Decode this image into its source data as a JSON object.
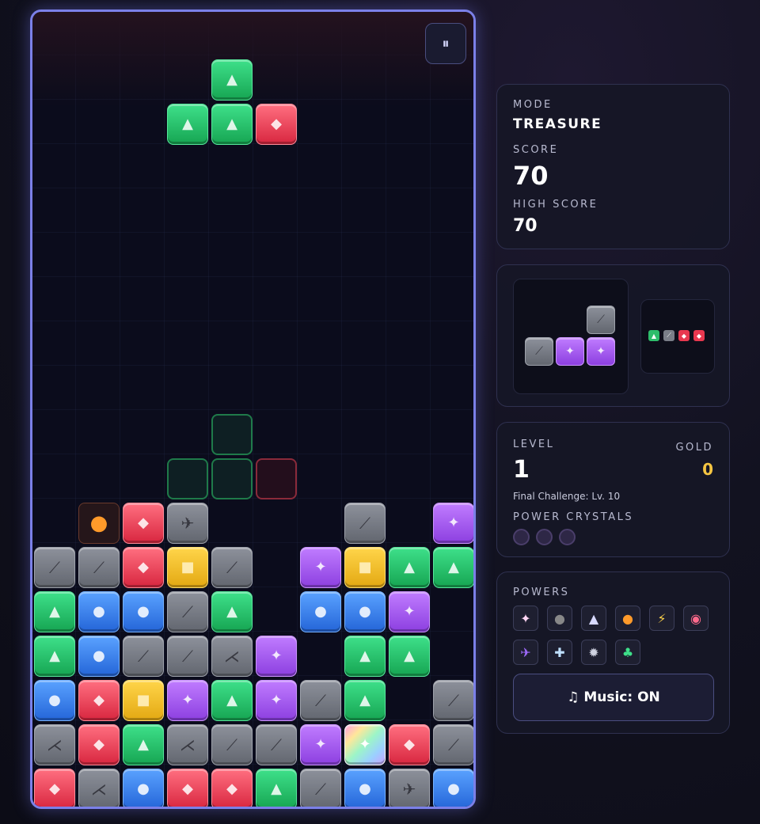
{
  "board": {
    "pause_label": "⏸",
    "cells": [
      {
        "col": 4,
        "row": 1,
        "color": "green",
        "sym": "▲"
      },
      {
        "col": 3,
        "row": 2,
        "color": "green",
        "sym": "▲"
      },
      {
        "col": 4,
        "row": 2,
        "color": "green",
        "sym": "▲"
      },
      {
        "col": 5,
        "row": 2,
        "color": "red",
        "sym": "◆"
      },
      {
        "col": 4,
        "row": 9,
        "color": "ghost-g",
        "sym": ""
      },
      {
        "col": 3,
        "row": 10,
        "color": "ghost-g",
        "sym": ""
      },
      {
        "col": 4,
        "row": 10,
        "color": "ghost-g",
        "sym": ""
      },
      {
        "col": 5,
        "row": 10,
        "color": "ghost-r",
        "sym": ""
      },
      {
        "col": 1,
        "row": 11,
        "color": "bomb",
        "sym": "●"
      },
      {
        "col": 2,
        "row": 11,
        "color": "red",
        "sym": "◆"
      },
      {
        "col": 3,
        "row": 11,
        "color": "gray",
        "sym": "✈"
      },
      {
        "col": 7,
        "row": 11,
        "color": "gray",
        "sym": "⟋"
      },
      {
        "col": 9,
        "row": 11,
        "color": "purple",
        "sym": "✦"
      },
      {
        "col": 0,
        "row": 12,
        "color": "gray",
        "sym": "⟋"
      },
      {
        "col": 1,
        "row": 12,
        "color": "gray",
        "sym": "⟋"
      },
      {
        "col": 2,
        "row": 12,
        "color": "red",
        "sym": "◆"
      },
      {
        "col": 3,
        "row": 12,
        "color": "yellow",
        "sym": "■"
      },
      {
        "col": 4,
        "row": 12,
        "color": "gray",
        "sym": "⟋"
      },
      {
        "col": 6,
        "row": 12,
        "color": "purple",
        "sym": "✦"
      },
      {
        "col": 7,
        "row": 12,
        "color": "yellow",
        "sym": "■"
      },
      {
        "col": 8,
        "row": 12,
        "color": "green",
        "sym": "▲"
      },
      {
        "col": 9,
        "row": 12,
        "color": "green",
        "sym": "▲"
      },
      {
        "col": 0,
        "row": 13,
        "color": "green",
        "sym": "▲"
      },
      {
        "col": 1,
        "row": 13,
        "color": "blue",
        "sym": "●"
      },
      {
        "col": 2,
        "row": 13,
        "color": "blue",
        "sym": "●"
      },
      {
        "col": 3,
        "row": 13,
        "color": "gray",
        "sym": "⟋"
      },
      {
        "col": 4,
        "row": 13,
        "color": "green",
        "sym": "▲"
      },
      {
        "col": 6,
        "row": 13,
        "color": "blue",
        "sym": "●"
      },
      {
        "col": 7,
        "row": 13,
        "color": "blue",
        "sym": "●"
      },
      {
        "col": 8,
        "row": 13,
        "color": "purple",
        "sym": "✦"
      },
      {
        "col": 0,
        "row": 14,
        "color": "green",
        "sym": "▲"
      },
      {
        "col": 1,
        "row": 14,
        "color": "blue",
        "sym": "●"
      },
      {
        "col": 2,
        "row": 14,
        "color": "gray",
        "sym": "⟋"
      },
      {
        "col": 3,
        "row": 14,
        "color": "gray",
        "sym": "⟋"
      },
      {
        "col": 4,
        "row": 14,
        "color": "gray",
        "sym": "⋌"
      },
      {
        "col": 5,
        "row": 14,
        "color": "purple",
        "sym": "✦"
      },
      {
        "col": 7,
        "row": 14,
        "color": "green",
        "sym": "▲"
      },
      {
        "col": 8,
        "row": 14,
        "color": "green",
        "sym": "▲"
      },
      {
        "col": 0,
        "row": 15,
        "color": "blue",
        "sym": "●"
      },
      {
        "col": 1,
        "row": 15,
        "color": "red",
        "sym": "◆"
      },
      {
        "col": 2,
        "row": 15,
        "color": "yellow",
        "sym": "■"
      },
      {
        "col": 3,
        "row": 15,
        "color": "purple",
        "sym": "✦"
      },
      {
        "col": 4,
        "row": 15,
        "color": "green",
        "sym": "▲"
      },
      {
        "col": 5,
        "row": 15,
        "color": "purple",
        "sym": "✦"
      },
      {
        "col": 6,
        "row": 15,
        "color": "gray",
        "sym": "⟋"
      },
      {
        "col": 7,
        "row": 15,
        "color": "green",
        "sym": "▲"
      },
      {
        "col": 9,
        "row": 15,
        "color": "gray",
        "sym": "⟋"
      },
      {
        "col": 0,
        "row": 16,
        "color": "gray",
        "sym": "⋌"
      },
      {
        "col": 1,
        "row": 16,
        "color": "red",
        "sym": "◆"
      },
      {
        "col": 2,
        "row": 16,
        "color": "green",
        "sym": "▲"
      },
      {
        "col": 3,
        "row": 16,
        "color": "gray",
        "sym": "⋌"
      },
      {
        "col": 4,
        "row": 16,
        "color": "gray",
        "sym": "⟋"
      },
      {
        "col": 5,
        "row": 16,
        "color": "gray",
        "sym": "⟋"
      },
      {
        "col": 6,
        "row": 16,
        "color": "purple",
        "sym": "✦"
      },
      {
        "col": 7,
        "row": 16,
        "color": "rainbow",
        "sym": "✦"
      },
      {
        "col": 8,
        "row": 16,
        "color": "red",
        "sym": "◆"
      },
      {
        "col": 9,
        "row": 16,
        "color": "gray",
        "sym": "⟋"
      },
      {
        "col": 0,
        "row": 17,
        "color": "red",
        "sym": "◆"
      },
      {
        "col": 1,
        "row": 17,
        "color": "gray",
        "sym": "⋌"
      },
      {
        "col": 2,
        "row": 17,
        "color": "blue",
        "sym": "●"
      },
      {
        "col": 3,
        "row": 17,
        "color": "red",
        "sym": "◆"
      },
      {
        "col": 4,
        "row": 17,
        "color": "red",
        "sym": "◆"
      },
      {
        "col": 5,
        "row": 17,
        "color": "green",
        "sym": "▲"
      },
      {
        "col": 6,
        "row": 17,
        "color": "gray",
        "sym": "⟋"
      },
      {
        "col": 7,
        "row": 17,
        "color": "blue",
        "sym": "●"
      },
      {
        "col": 8,
        "row": 17,
        "color": "gray",
        "sym": "✈"
      },
      {
        "col": 9,
        "row": 17,
        "color": "blue",
        "sym": "●"
      }
    ]
  },
  "stats": {
    "mode_label": "MODE",
    "mode_value": "TREASURE",
    "score_label": "SCORE",
    "score_value": "70",
    "high_label": "HIGH SCORE",
    "high_value": "70"
  },
  "level": {
    "level_label": "LEVEL",
    "level_value": "1",
    "gold_label": "GOLD",
    "gold_value": "0",
    "challenge": "Final Challenge: Lv. 10",
    "crystals_label": "POWER CRYSTALS",
    "crystals_filled": 0,
    "crystals_total": 3
  },
  "powers": {
    "label": "POWERS",
    "items": [
      {
        "name": "rainbow-power-icon",
        "glyph": "✦"
      },
      {
        "name": "bomb-power-icon",
        "glyph": "●"
      },
      {
        "name": "rocket-power-icon",
        "glyph": "▲"
      },
      {
        "name": "fire-power-icon",
        "glyph": "●"
      },
      {
        "name": "lightning-power-icon",
        "glyph": "⚡"
      },
      {
        "name": "color-wheel-power-icon",
        "glyph": "◉"
      },
      {
        "name": "plane-power-icon",
        "glyph": "✈"
      },
      {
        "name": "cross-power-icon",
        "glyph": "✚"
      },
      {
        "name": "gear-power-icon",
        "glyph": "✹"
      },
      {
        "name": "sprout-power-icon",
        "glyph": "♣"
      }
    ],
    "music_label": "♫ Music: ON"
  },
  "colors": {
    "accent": "#7b80e8",
    "gold": "#f5c542"
  }
}
